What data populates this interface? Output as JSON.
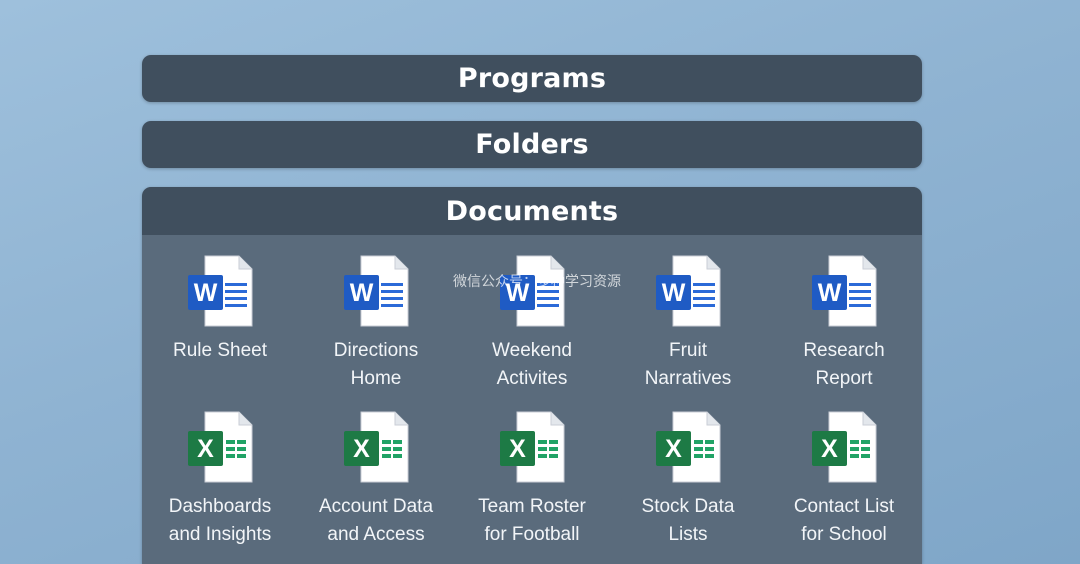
{
  "sections": {
    "programs": "Programs",
    "folders": "Folders",
    "documents": "Documents"
  },
  "documents": [
    {
      "type": "word",
      "icon": "word-document-icon",
      "line1": "Rule Sheet",
      "line2": ""
    },
    {
      "type": "word",
      "icon": "word-document-icon",
      "line1": "Directions",
      "line2": "Home"
    },
    {
      "type": "word",
      "icon": "word-document-icon",
      "line1": "Weekend",
      "line2": "Activites"
    },
    {
      "type": "word",
      "icon": "word-document-icon",
      "line1": "Fruit",
      "line2": "Narratives"
    },
    {
      "type": "word",
      "icon": "word-document-icon",
      "line1": "Research",
      "line2": "Report"
    },
    {
      "type": "excel",
      "icon": "excel-spreadsheet-icon",
      "line1": "Dashboards",
      "line2": "and Insights"
    },
    {
      "type": "excel",
      "icon": "excel-spreadsheet-icon",
      "line1": "Account Data",
      "line2": "and Access"
    },
    {
      "type": "excel",
      "icon": "excel-spreadsheet-icon",
      "line1": "Team Roster",
      "line2": "for Football"
    },
    {
      "type": "excel",
      "icon": "excel-spreadsheet-icon",
      "line1": "Stock Data",
      "line2": "Lists"
    },
    {
      "type": "excel",
      "icon": "excel-spreadsheet-icon",
      "line1": "Contact List",
      "line2": "for School"
    }
  ],
  "watermark": "微信公众号：多种学习资源",
  "colors": {
    "bar": "#404f5e",
    "panel": "#5a6b7c",
    "word_blue": "#1f5bc4",
    "excel_green": "#1d7a45"
  }
}
